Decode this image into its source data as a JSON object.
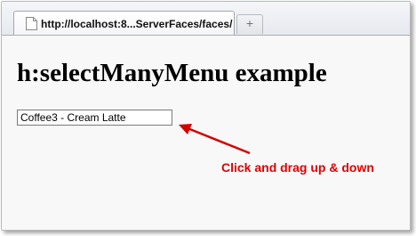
{
  "browser": {
    "tab_title": "http://localhost:8...ServerFaces/faces/",
    "new_tab_label": "+"
  },
  "page": {
    "heading": "h:selectManyMenu example",
    "menu": {
      "visible_option": "Coffee3 - Cream Latte"
    }
  },
  "annotation": {
    "text": "Click and drag up & down",
    "color": "#e00000"
  },
  "icons": [
    "page-icon",
    "new-tab-icon",
    "arrow-icon"
  ]
}
